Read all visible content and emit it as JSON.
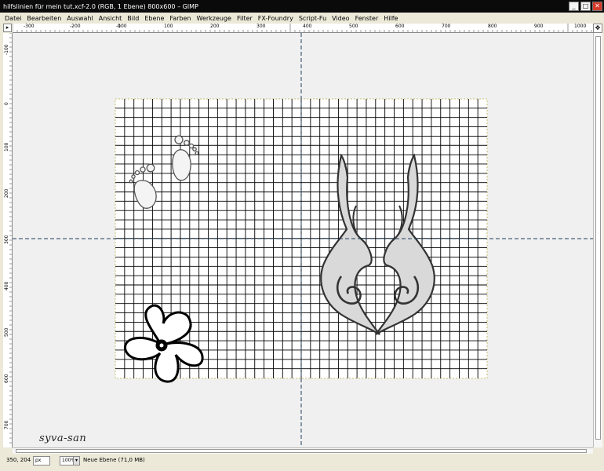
{
  "window": {
    "title": "hilfslinien für mein tut.xcf-2.0 (RGB, 1 Ebene) 800x600 – GIMP",
    "minimize_glyph": "_",
    "maximize_glyph": "□",
    "close_glyph": "✕"
  },
  "menu": [
    "Datei",
    "Bearbeiten",
    "Auswahl",
    "Ansicht",
    "Bild",
    "Ebene",
    "Farben",
    "Werkzeuge",
    "Filter",
    "FX-Foundry",
    "Script-Fu",
    "Video",
    "Fenster",
    "Hilfe"
  ],
  "ruler": {
    "corner_glyph": "▸",
    "nav_glyph": "✥",
    "h_labels": [
      "-300",
      "-200",
      "-100",
      "0",
      "100",
      "200",
      "300",
      "400",
      "500",
      "600",
      "700",
      "800",
      "900",
      "1000"
    ],
    "v_labels": [
      "-100",
      "0",
      "100",
      "200",
      "300",
      "400",
      "500",
      "600",
      "700"
    ]
  },
  "statusbar": {
    "coords": "350, 204",
    "unit": "px",
    "zoom": "100%",
    "zoom_arrow": "▾",
    "layer_info": "Neue Ebene (71,0 MB)"
  },
  "signature": "syva-san",
  "colors": {
    "titlebar": "#0a0a0a",
    "guide": "#1f3b5e",
    "grid": "#000000",
    "canvas": "#ffffff",
    "viewport": "#f0f0f0"
  }
}
